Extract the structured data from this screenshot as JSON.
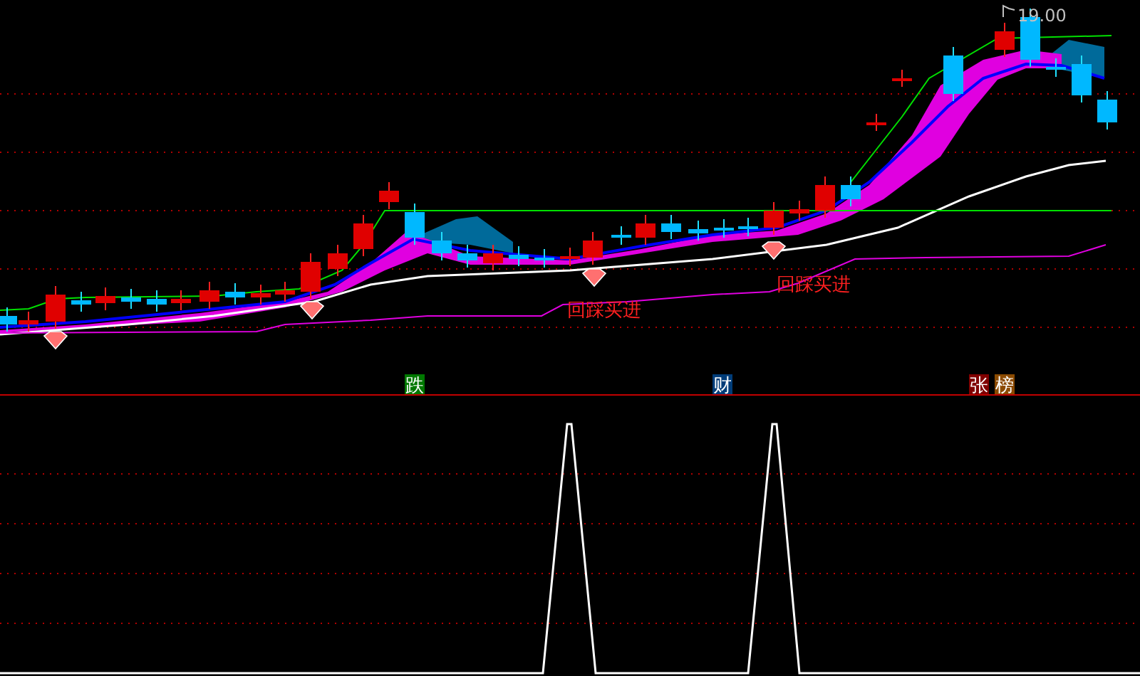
{
  "price_chart": {
    "high_label": "19.00",
    "signals": [
      {
        "text": "回踩买进"
      },
      {
        "text": "回踩买进"
      }
    ]
  },
  "tags": [
    {
      "text": "跌",
      "color": "#007800"
    },
    {
      "text": "财",
      "color": "#003c78"
    },
    {
      "text": "张",
      "color": "#800000"
    },
    {
      "text": "榜",
      "color": "#8b4a00"
    }
  ]
}
